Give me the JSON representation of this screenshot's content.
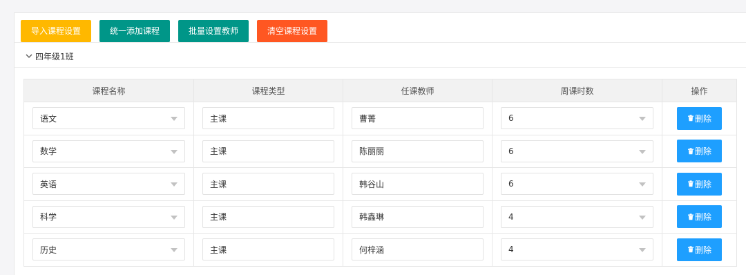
{
  "toolbar": {
    "buttons": [
      {
        "label": "导入课程设置",
        "color": "#FFB800"
      },
      {
        "label": "统一添加课程",
        "color": "#009688"
      },
      {
        "label": "批量设置教师",
        "color": "#009688"
      },
      {
        "label": "清空课程设置",
        "color": "#FF5722"
      }
    ]
  },
  "group": {
    "title": "四年级1班",
    "icon": "chevron-down-icon"
  },
  "table": {
    "headers": [
      "课程名称",
      "课程类型",
      "任课教师",
      "周课时数",
      "操作"
    ],
    "rows": [
      {
        "course": "语文",
        "type": "主课",
        "teacher": "曹菁",
        "hours": "6",
        "action": "删除"
      },
      {
        "course": "数学",
        "type": "主课",
        "teacher": "陈丽丽",
        "hours": "6",
        "action": "删除"
      },
      {
        "course": "英语",
        "type": "主课",
        "teacher": "韩谷山",
        "hours": "6",
        "action": "删除"
      },
      {
        "course": "科学",
        "type": "主课",
        "teacher": "韩鑫琳",
        "hours": "4",
        "action": "删除"
      },
      {
        "course": "历史",
        "type": "主课",
        "teacher": "何梓涵",
        "hours": "4",
        "action": "删除"
      }
    ]
  },
  "colors": {
    "delete_button": "#1E9FFF",
    "header_bg": "#f2f2f2"
  }
}
